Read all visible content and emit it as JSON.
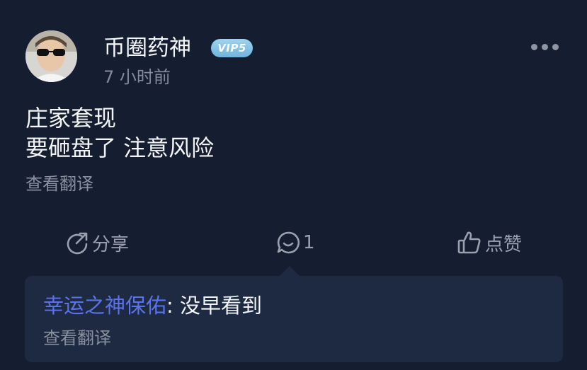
{
  "post": {
    "author": "币圈药神",
    "vip_badge": "VIP5",
    "time": "7 小时前",
    "lines": [
      "庄家套现",
      "要砸盘了 注意风险"
    ],
    "translate_label": "查看翻译"
  },
  "actions": {
    "share_label": "分享",
    "comment_count": "1",
    "like_label": "点赞"
  },
  "comment": {
    "author": "幸运之神保佑",
    "separator": ": ",
    "text": "没早看到",
    "translate_label": "查看翻译"
  },
  "icons": [
    "avatar-photo",
    "more-dots-icon",
    "share-icon",
    "comment-icon",
    "thumbs-up-icon"
  ],
  "colors": {
    "background": "#151d31",
    "comment_bg": "#1e2942",
    "vip_badge": "#8cc8ea",
    "comment_author": "#5b73e8"
  }
}
